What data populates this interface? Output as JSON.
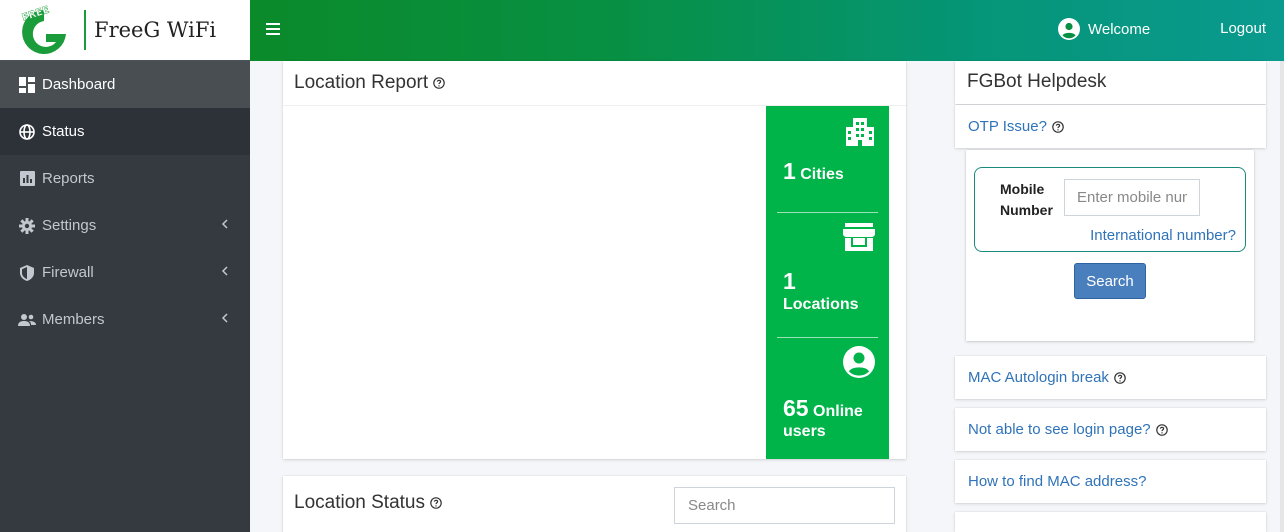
{
  "brand": {
    "name": "FreeG WiFi",
    "logo_text": "FREE"
  },
  "sidebar": {
    "items": [
      {
        "label": "Dashboard",
        "icon": "dashboard-icon",
        "state": "active"
      },
      {
        "label": "Status",
        "icon": "globe-icon",
        "state": "hovered"
      },
      {
        "label": "Reports",
        "icon": "chart-icon",
        "state": ""
      },
      {
        "label": "Settings",
        "icon": "gear-icon",
        "state": "",
        "has_submenu": true
      },
      {
        "label": "Firewall",
        "icon": "shield-icon",
        "state": "",
        "has_submenu": true
      },
      {
        "label": "Members",
        "icon": "users-icon",
        "state": "",
        "has_submenu": true
      }
    ]
  },
  "topbar": {
    "welcome": "Welcome",
    "logout": "Logout"
  },
  "location_report": {
    "title": "Location Report",
    "stats": [
      {
        "value": "1",
        "label": "Cities",
        "icon": "building-icon"
      },
      {
        "value": "1",
        "label": "Locations",
        "icon": "store-icon"
      },
      {
        "value": "65",
        "label": "Online users",
        "icon": "user-circle-icon"
      }
    ]
  },
  "location_status": {
    "title": "Location Status",
    "search_placeholder": "Search"
  },
  "helpdesk": {
    "title": "FGBot Helpdesk",
    "otp": {
      "title": "OTP Issue?",
      "mobile_label": "Mobile Number",
      "mobile_placeholder": "Enter mobile number",
      "international_link": "International number?",
      "search_button": "Search"
    },
    "items": [
      "MAC Autologin break",
      "Not able to see login page?",
      "How to find MAC address?"
    ]
  },
  "colors": {
    "accent_green": "#00b44a",
    "sidebar_bg": "#343a40",
    "link_blue": "#2f73b8",
    "button_blue": "#4a7fbd"
  }
}
